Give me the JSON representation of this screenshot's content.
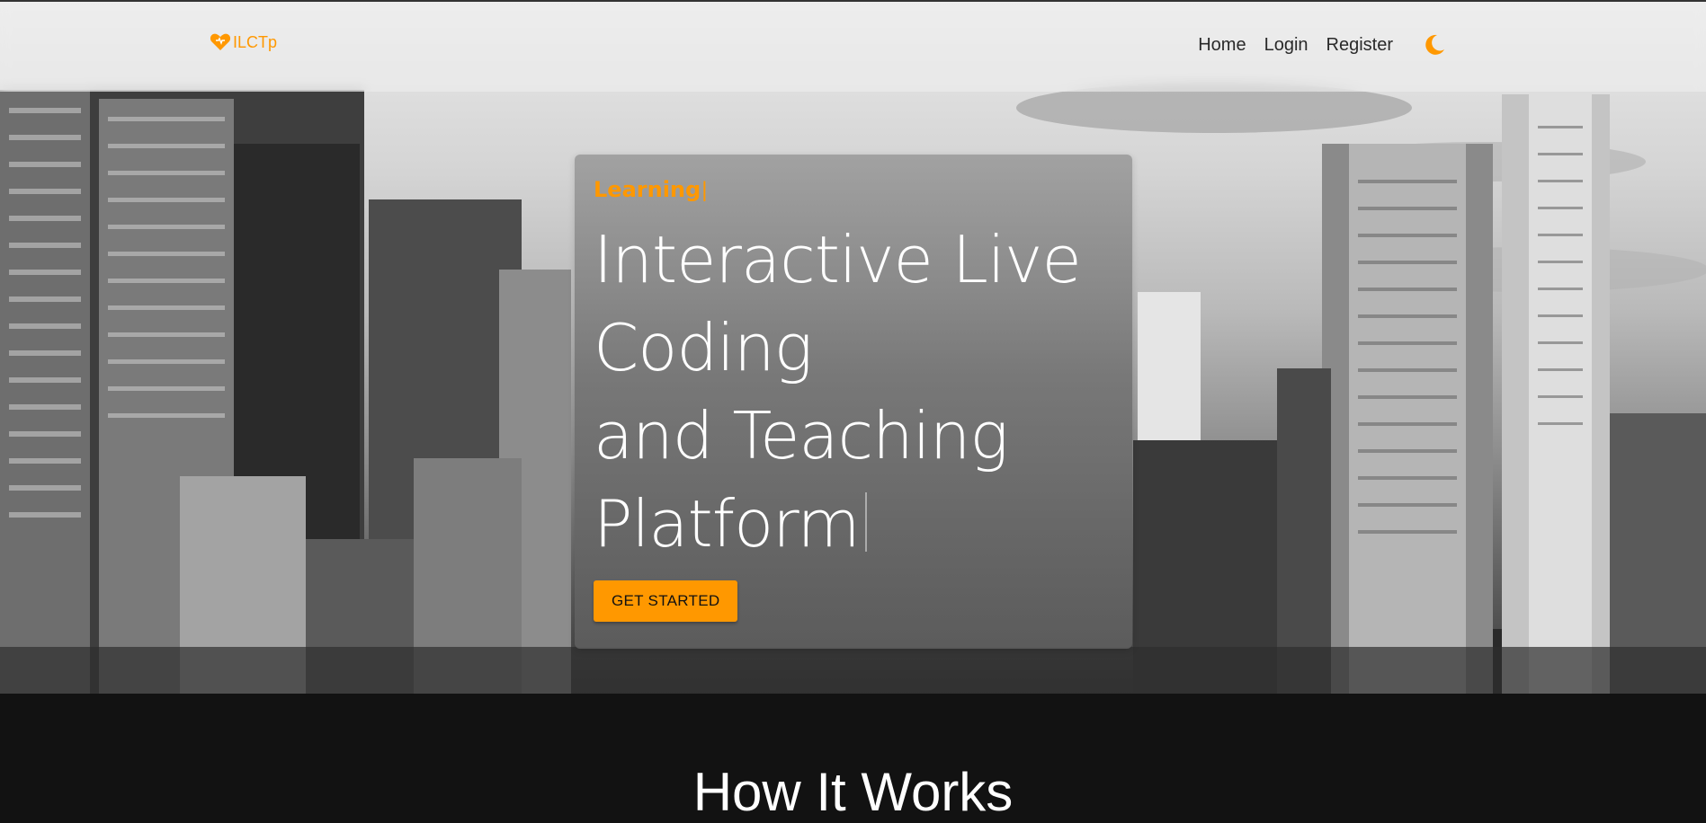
{
  "colors": {
    "accent": "#ff9800",
    "nav_text": "#2a2a2a",
    "section_bg": "#121212",
    "headline_text": "#ffffff"
  },
  "navbar": {
    "brand_icon": "heart-icon",
    "brand_label": "ILCTp",
    "links": [
      {
        "label": "Home"
      },
      {
        "label": "Login"
      },
      {
        "label": "Register"
      }
    ],
    "theme_toggle_icon": "moon-icon"
  },
  "hero": {
    "typing_word": "Learning",
    "headline_lines": [
      "Interactive Live",
      "Coding",
      "and Teaching",
      "Platform"
    ],
    "cta_label": "GET STARTED"
  },
  "how_it_works": {
    "title": "How It Works"
  }
}
